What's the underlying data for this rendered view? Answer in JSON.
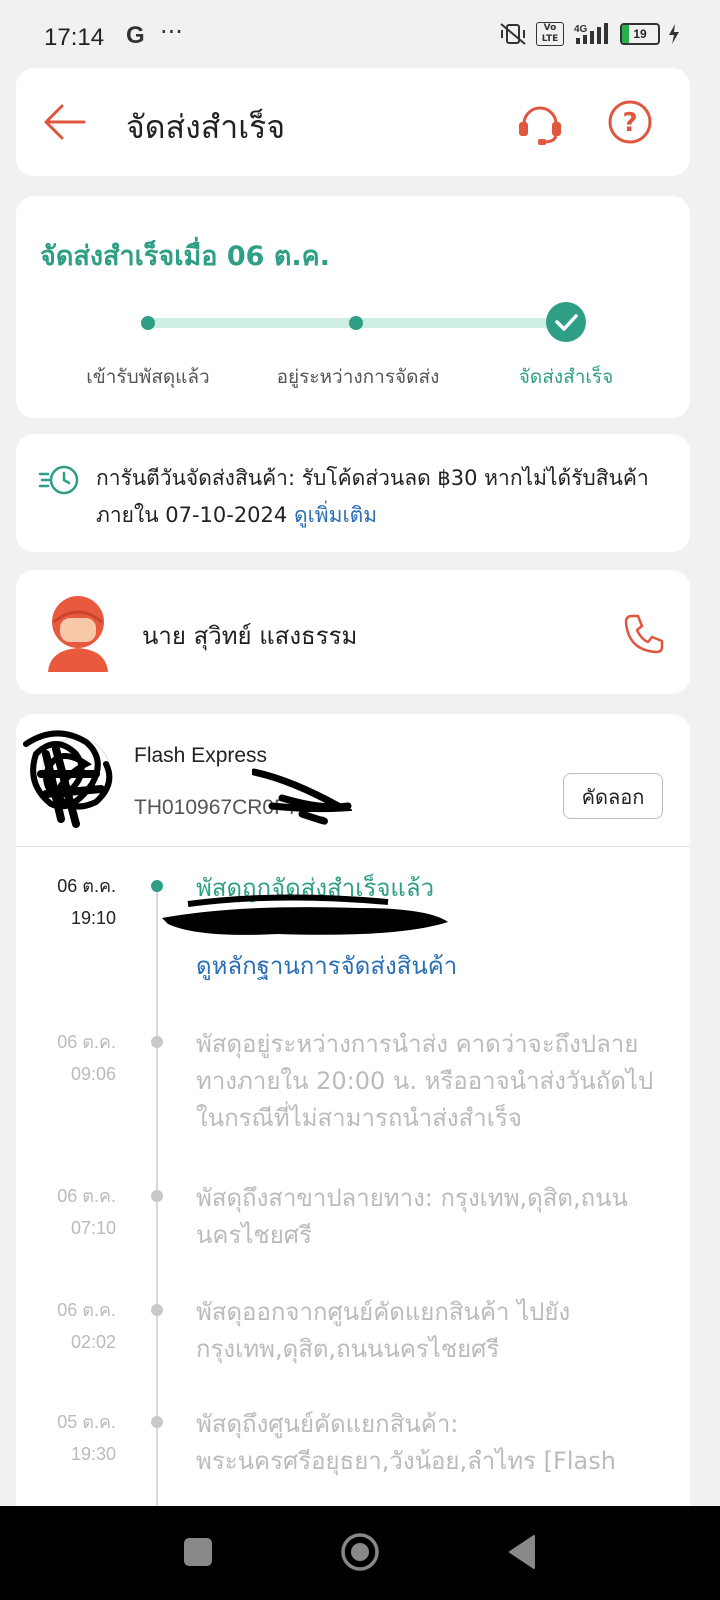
{
  "status_bar": {
    "time": "17:14",
    "g_icon": "G",
    "more": "···",
    "network": "4G",
    "volte": "Vo LTE",
    "battery": "19"
  },
  "header": {
    "title": "จัดส่งสำเร็จ",
    "icons": [
      "back-arrow-icon",
      "headset-icon",
      "help-icon"
    ]
  },
  "delivery_status": {
    "headline": "จัดส่งสำเร็จเมื่อ 06 ต.ค.",
    "steps": [
      {
        "label": "เข้ารับพัสดุแล้ว"
      },
      {
        "label": "อยู่ระหว่างการจัดส่ง"
      },
      {
        "label": "จัดส่งสำเร็จ"
      }
    ],
    "accent_color": "#2e9e85"
  },
  "guarantee": {
    "text": "การันตีวันจัดส่งสินค้า: รับโค้ดส่วนลด ฿30 หากไม่ได้รับสินค้าภายใน 07-10-2024",
    "link": "ดูเพิ่มเติม"
  },
  "courier": {
    "name": "นาย สุวิทย์ แสงธรรม"
  },
  "shipment": {
    "carrier": "Flash Express",
    "tracking_no": "TH010967CR0F7",
    "copy_label": "คัดลอก"
  },
  "timeline": [
    {
      "date": "06 ต.ค.",
      "time": "19:10",
      "text": "พัสดุถูกจัดส่งสำเร็จแล้ว",
      "link": "ดูหลักฐานการจัดส่งสินค้า"
    },
    {
      "date": "06 ต.ค.",
      "time": "09:06",
      "text": "พัสดุอยู่ระหว่างการนำส่ง คาดว่าจะถึงปลายทางภายใน 20:00 น. หรืออาจนำส่งวันถัดไป ในกรณีที่ไม่สามารถนำส่งสำเร็จ"
    },
    {
      "date": "06 ต.ค.",
      "time": "07:10",
      "text": "พัสดุถึงสาขาปลายทาง: กรุงเทพ,ดุสิต,ถนนนครไชยศรี"
    },
    {
      "date": "06 ต.ค.",
      "time": "02:02",
      "text": "พัสดุออกจากศูนย์คัดแยกสินค้า ไปยัง กรุงเทพ,ดุสิต,ถนนนครไชยศรี"
    },
    {
      "date": "05 ต.ค.",
      "time": "19:30",
      "text": "พัสดุถึงศูนย์คัดแยกสินค้า: พระนครศรีอยุธยา,วังน้อย,ลำไทร  [Flash"
    }
  ]
}
